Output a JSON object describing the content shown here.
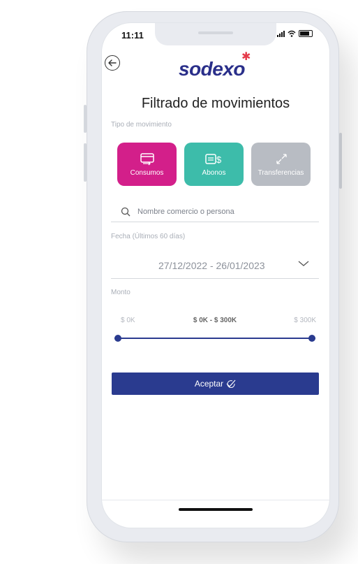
{
  "status_bar": {
    "time": "11:11"
  },
  "header": {
    "logo_text": "sodexo",
    "title": "Filtrado de movimientos"
  },
  "filters": {
    "type_label": "Tipo de movimiento",
    "types": [
      {
        "label": "Consumos",
        "color": "#d31f8a",
        "icon": "card-arrows-icon"
      },
      {
        "label": "Abonos",
        "color": "#3dbcaa",
        "icon": "card-dollar-icon"
      },
      {
        "label": "Transferencias",
        "color": "#b8bcc3",
        "icon": "transfer-arrows-icon"
      }
    ],
    "search": {
      "placeholder": "Nombre comercio o persona"
    },
    "date_label": "Fecha (Últimos 60 días)",
    "date_value": "27/12/2022 - 26/01/2023",
    "amount_label": "Monto",
    "amount_min": "$ 0K",
    "amount_range": "$ 0K - $ 300K",
    "amount_max": "$ 300K",
    "slider": {
      "low_fraction": 0,
      "high_fraction": 1
    }
  },
  "actions": {
    "accept_label": "Aceptar"
  },
  "colors": {
    "primary": "#2a3b8f",
    "brand_accent": "#e53b4a"
  }
}
